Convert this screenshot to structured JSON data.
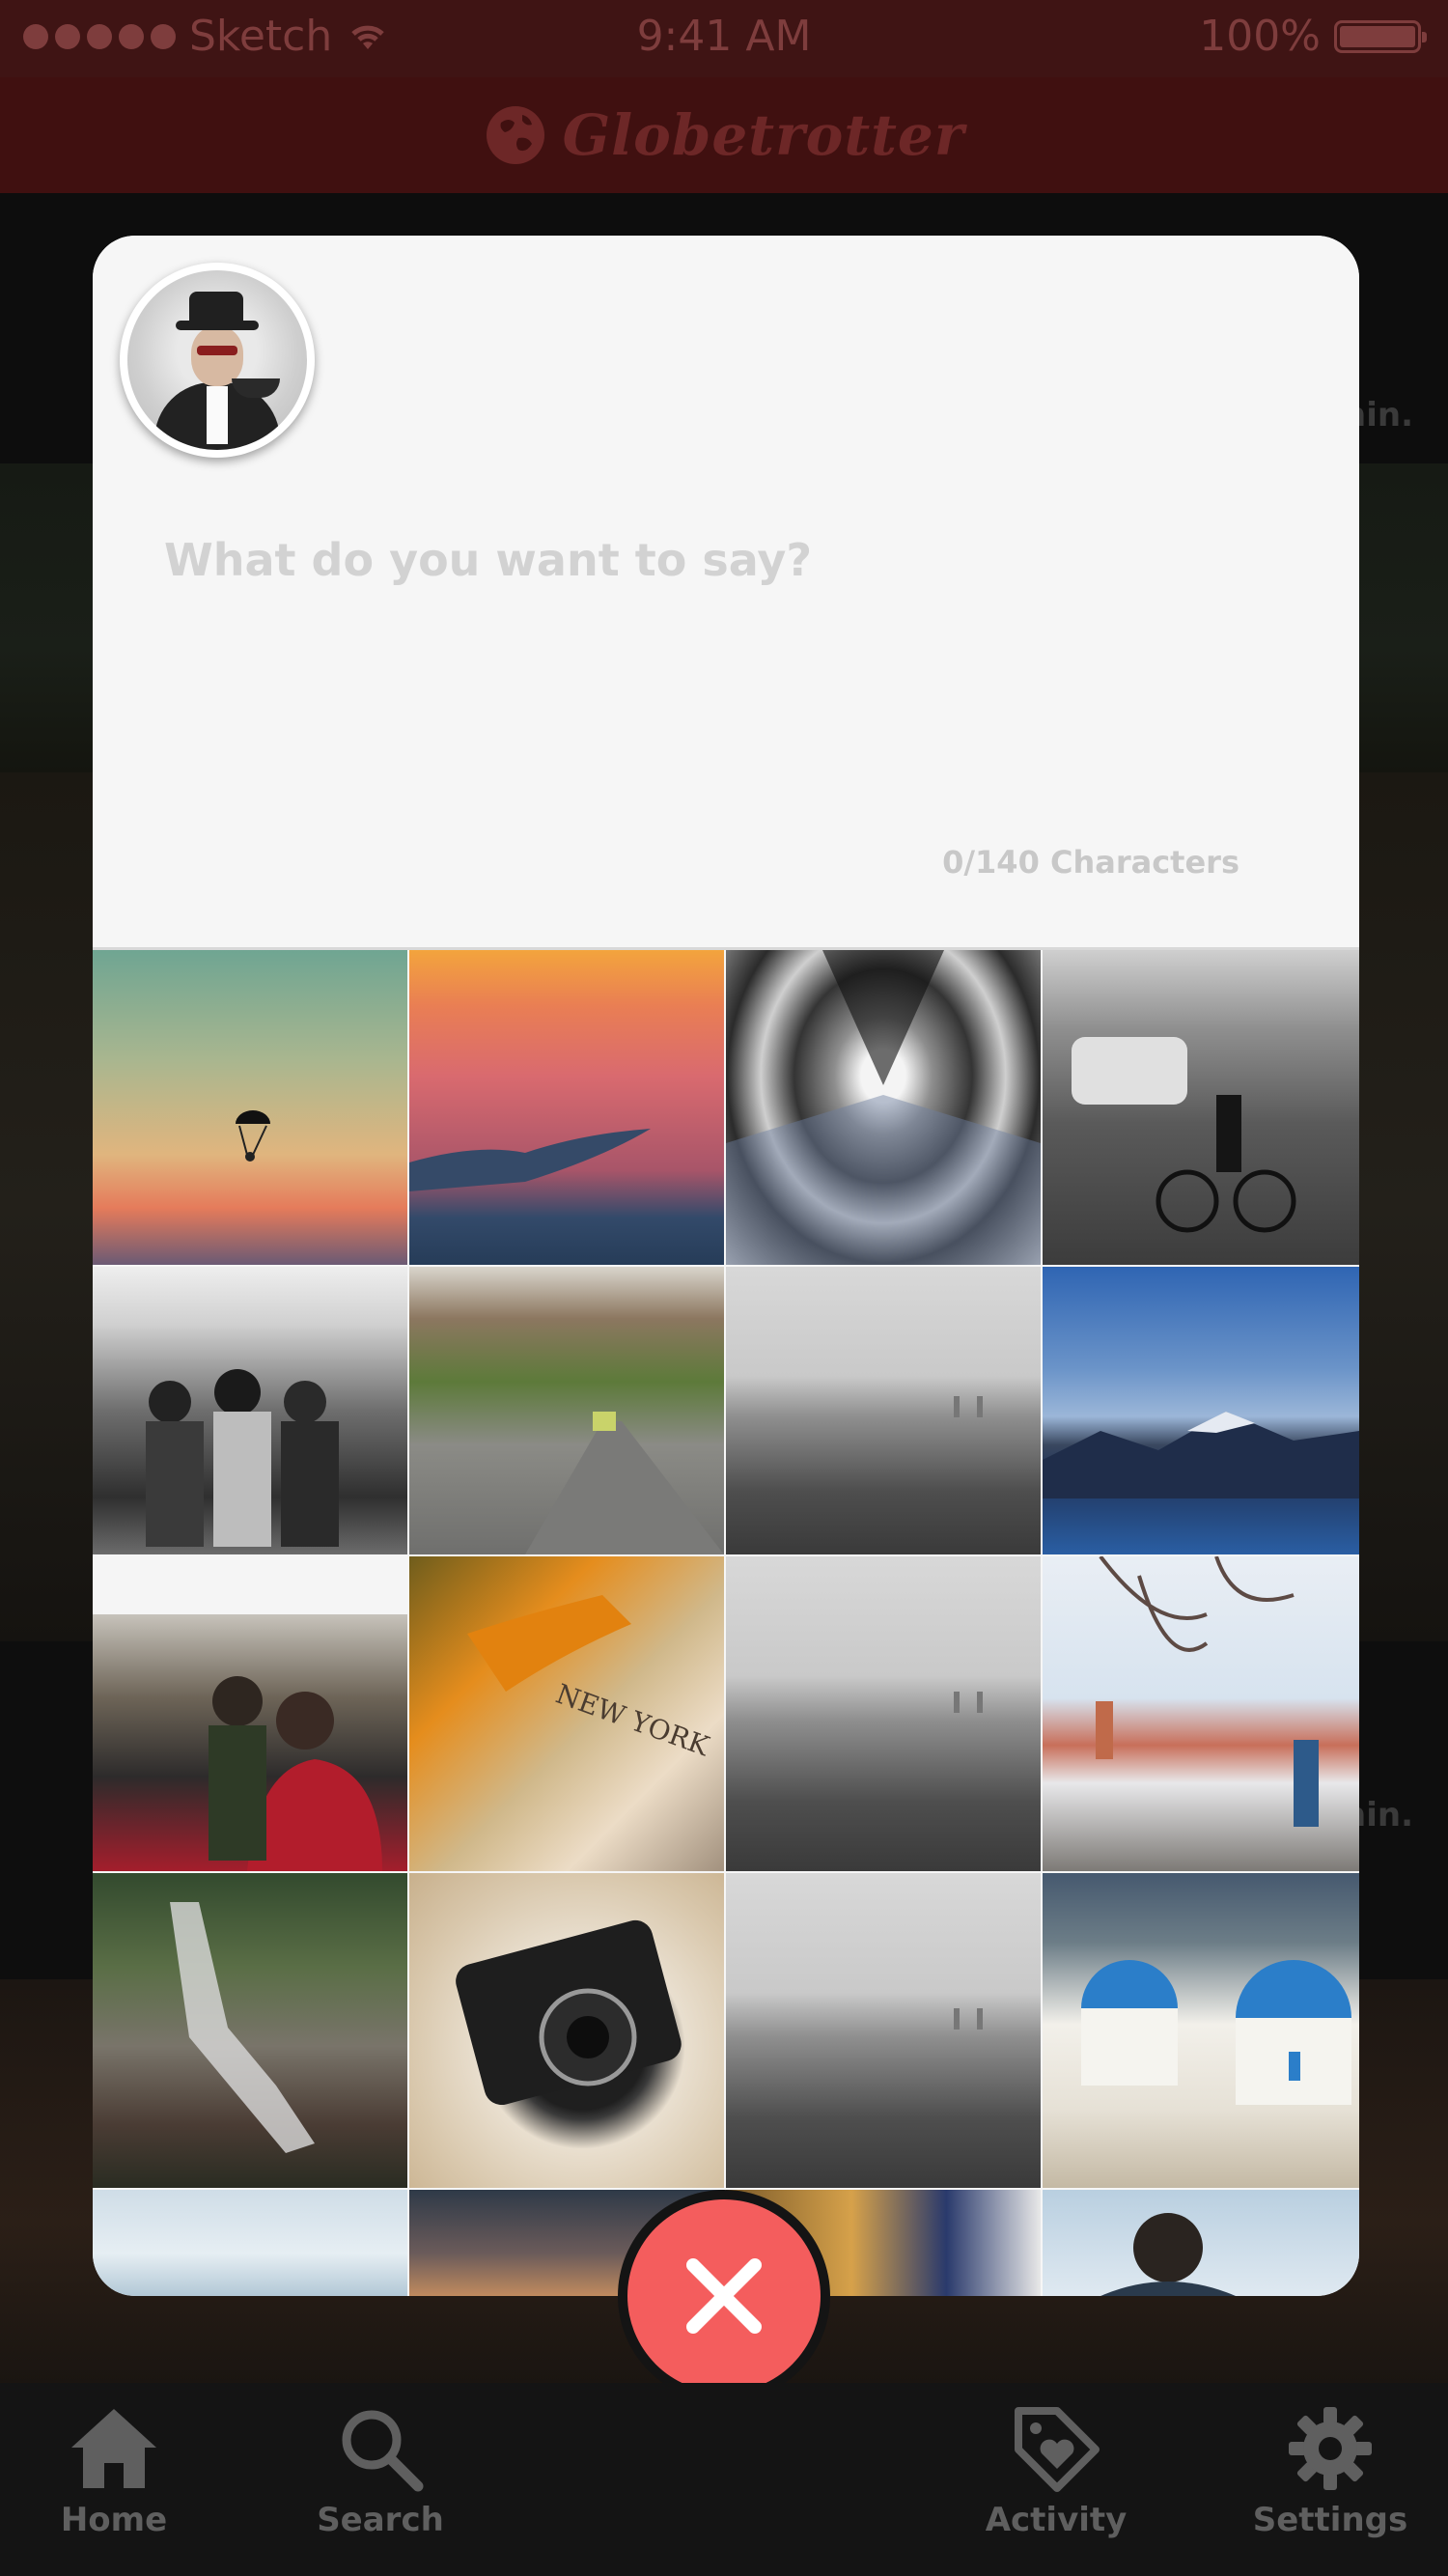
{
  "status_bar": {
    "carrier": "Sketch",
    "time": "9:41 AM",
    "battery": "100%"
  },
  "nav": {
    "title": "Globetrotter"
  },
  "background_feed": {
    "ghost_time_1": "min.",
    "ghost_time_2": "min."
  },
  "compose": {
    "placeholder": "What do you want to say?",
    "counter": "0/140 Characters"
  },
  "photos": [
    "parachute-sunset",
    "coastline-sunset",
    "airport-tunnel",
    "city-street-cyclist",
    "crowded-train",
    "city-avenue",
    "foggy-city",
    "mountain-lake",
    "airplane-cabin",
    "map-new-york",
    "foggy-city",
    "winter-town",
    "waterfall",
    "vintage-camera",
    "foggy-city",
    "santorini-domes",
    "sky",
    "dusk",
    "market",
    "man-portrait"
  ],
  "close_button": "close",
  "tabs": [
    {
      "label": "Home",
      "icon": "home-icon"
    },
    {
      "label": "Search",
      "icon": "search-icon"
    },
    {
      "label": "Activity",
      "icon": "activity-icon"
    },
    {
      "label": "Settings",
      "icon": "settings-icon"
    }
  ],
  "colors": {
    "brand_bar": "#401010",
    "accent_close": "#f45d5d",
    "tab_inactive": "#5f5f5f"
  }
}
